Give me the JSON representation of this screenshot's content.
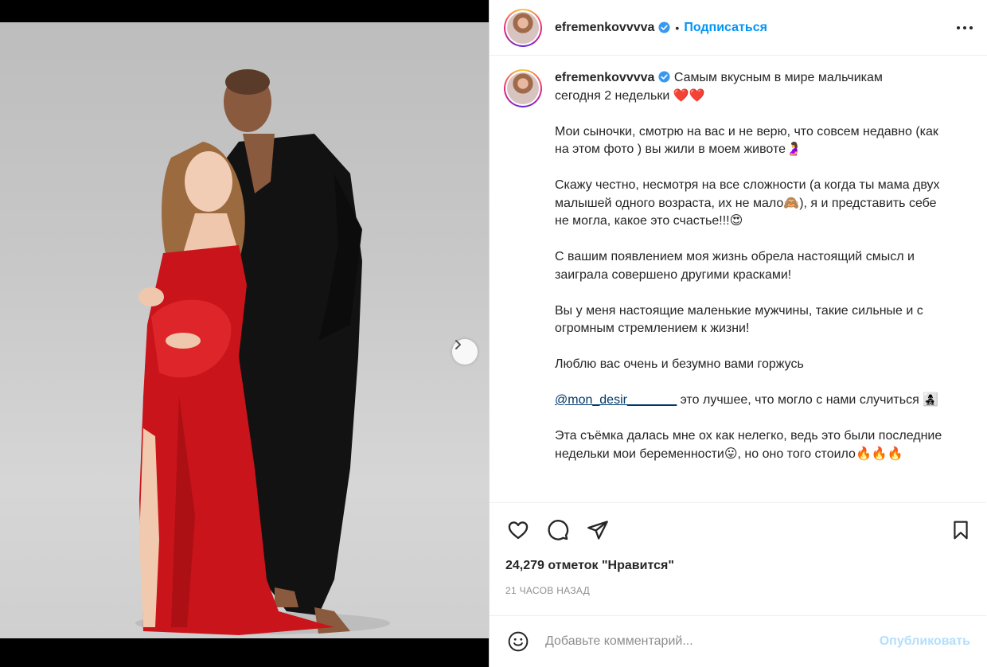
{
  "post": {
    "username": "efremenkovvvva",
    "follow_label": "Подписаться",
    "separator": "•",
    "caption": {
      "line1": "Самым вкусным в мире мальчикам",
      "line2": "сегодня 2 недельки ❤️❤️",
      "p2": "Мои сыночки, смотрю на вас и не верю, что совсем недавно (как на этом фото ) вы жили в моем животе🤰",
      "p3": "Скажу честно, несмотря на все сложности (а когда ты мама двух малышей одного возраста, их не мало🙈), я и представить себе не могла, какое это счастье!!!😍",
      "p4": "С вашим появлением моя жизнь обрела настоящий смысл и заиграла совершено другими красками!",
      "p5": "Вы у меня настоящие маленькие мужчины, такие сильные и с огромным стремлением к жизни!",
      "p6": "Люблю вас очень и безумно вами горжусь",
      "mention": "@mon_desir_______",
      "p7_rest": " это лучшее, что могло с нами случиться 👩‍👧‍👦",
      "p8": "Эта съёмка далась мне ох как нелегко, ведь это были последние недельки мои беременности😛, но оно того стоило🔥🔥🔥"
    },
    "likes_text": "24,279 отметок \"Нравится\"",
    "time_text": "21 ЧАСОВ НАЗАД",
    "comment_placeholder": "Добавьте комментарий...",
    "publish_label": "Опубликовать"
  },
  "media": {
    "slide_count": 2,
    "active_slide": 1
  },
  "icons": {
    "verified": "verified-badge-icon",
    "more": "more-options-icon",
    "like": "heart-icon",
    "comment": "comment-icon",
    "share": "share-icon",
    "save": "bookmark-icon",
    "emoji": "emoji-icon",
    "next": "chevron-right-icon"
  },
  "colors": {
    "accent": "#0095f6",
    "publish_disabled": "#b2dffc",
    "dress": "#c8141a"
  }
}
